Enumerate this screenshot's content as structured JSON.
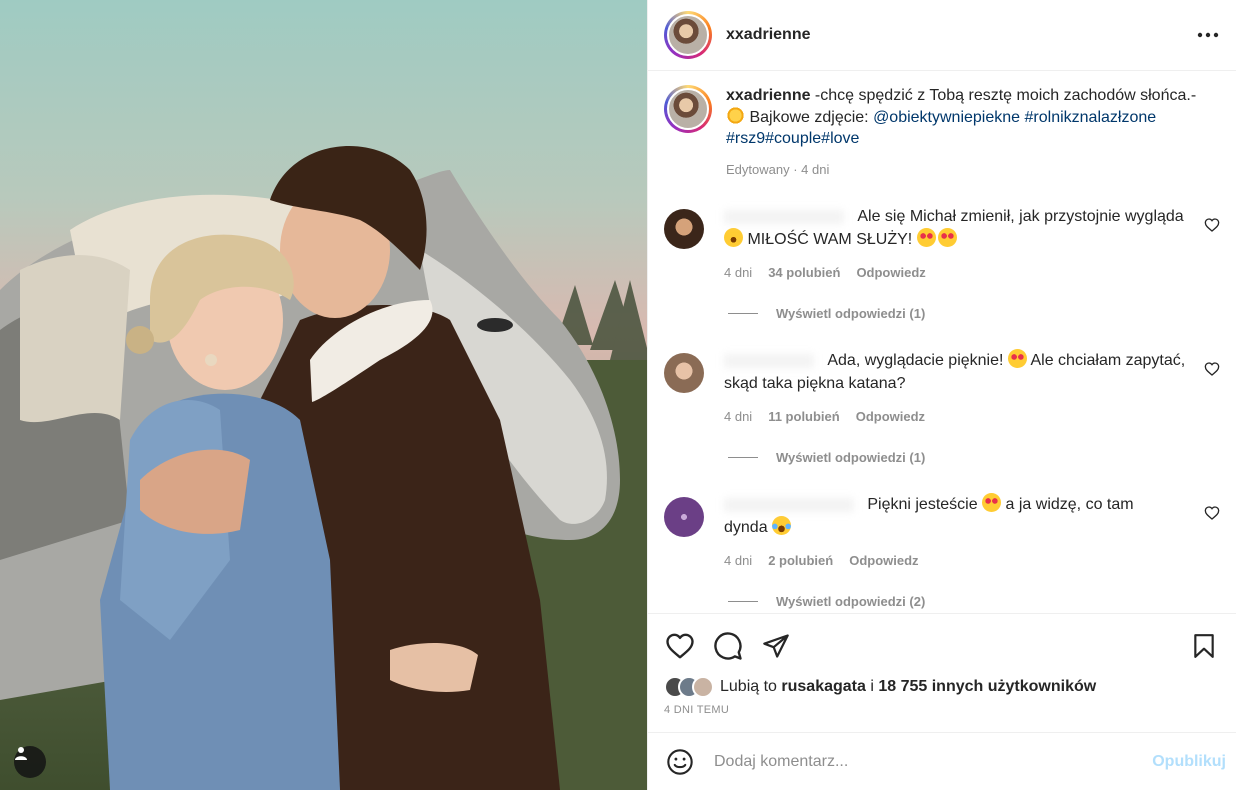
{
  "post": {
    "username": "xxadrienne",
    "more_icon": "more-horizontal-icon",
    "caption": {
      "username": "xxadrienne",
      "text_1": " -chcę spędzić z Tobą resztę moich zachodów słońca.-",
      "emoji": "sun-emoji",
      "text_2": " Bajkowe zdjęcie: ",
      "mention": "@obiektywniepiekne",
      "hashtag_1": "#rolnikznalazłzone",
      "hashtag_2": "#rsz9#couple#love",
      "edited_label": "Edytowany",
      "sep": " · ",
      "time": "4 dni"
    }
  },
  "comments": [
    {
      "text_1": "Ale się Michał zmienił, jak przystojnie wygląda",
      "text_2": "MIŁOŚĆ WAM SŁUŻY!",
      "time": "4 dni",
      "likes": "34 polubień",
      "reply": "Odpowiedz",
      "view_replies": "Wyświetl odpowiedzi (1)"
    },
    {
      "text_1": "Ada, wyglądacie pięknie!",
      "text_2": " Ale chciałam zapytać,",
      "text_3": "skąd taka piękna katana?",
      "time": "4 dni",
      "likes": "11 polubień",
      "reply": "Odpowiedz",
      "view_replies": "Wyświetl odpowiedzi (1)"
    },
    {
      "text_1": "Piękni jesteście",
      "text_2": " a ja widzę, co tam",
      "text_3": "dynda",
      "time": "4 dni",
      "likes": "2 polubień",
      "reply": "Odpowiedz",
      "view_replies": "Wyświetl odpowiedzi (2)"
    }
  ],
  "actions": {
    "like_icon": "heart-icon",
    "comment_icon": "comment-icon",
    "share_icon": "send-icon",
    "save_icon": "bookmark-icon"
  },
  "likes": {
    "prefix": "Lubią to ",
    "user": "rusakagata",
    "mid": " i ",
    "count": "18 755 innych użytkowników"
  },
  "time_ago": "4 DNI TEMU",
  "add_comment": {
    "placeholder": "Dodaj komentarz...",
    "publish": "Opublikuj"
  },
  "colors": {
    "link": "#00376b",
    "publish_disabled": "#b2dffc",
    "muted": "#8e8e8e"
  }
}
